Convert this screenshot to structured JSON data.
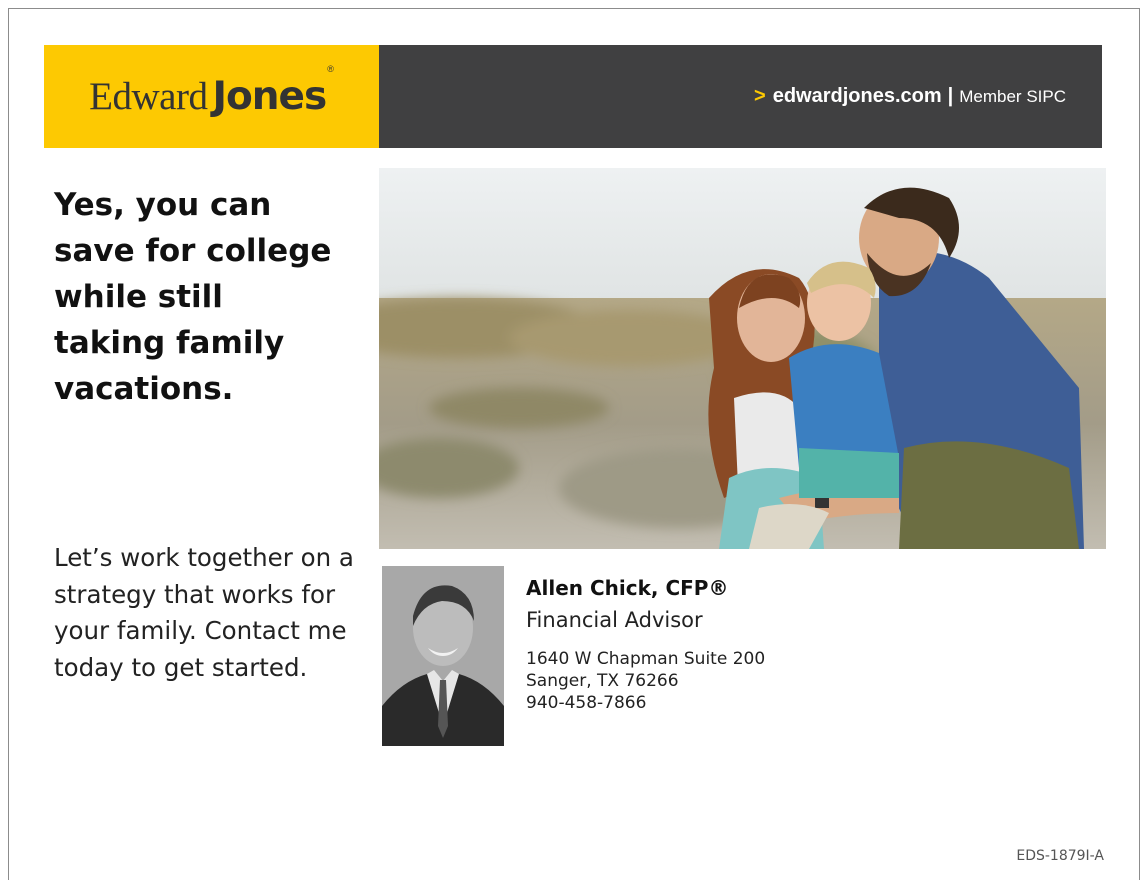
{
  "brand": {
    "logo_first": "Edward",
    "logo_second": "Jones",
    "logo_mark": "®",
    "primary_color": "#fdc902",
    "bar_color": "#404041"
  },
  "header": {
    "arrow": ">",
    "url": "edwardjones.com",
    "separator": "|",
    "member": "Member SIPC"
  },
  "headline": "Yes, you can save for college while still taking family vacations.",
  "body_copy": "Let’s work together on a strategy that works for your family. Contact me today to get started.",
  "photo": {
    "subject": "family-photo"
  },
  "advisor": {
    "name": "Allen Chick, CFP®",
    "title": "Financial Advisor",
    "address_line1": "1640 W Chapman Suite 200",
    "address_line2": "Sanger, TX 76266",
    "phone": "940-458-7866"
  },
  "doc_code": "EDS-1879I-A"
}
